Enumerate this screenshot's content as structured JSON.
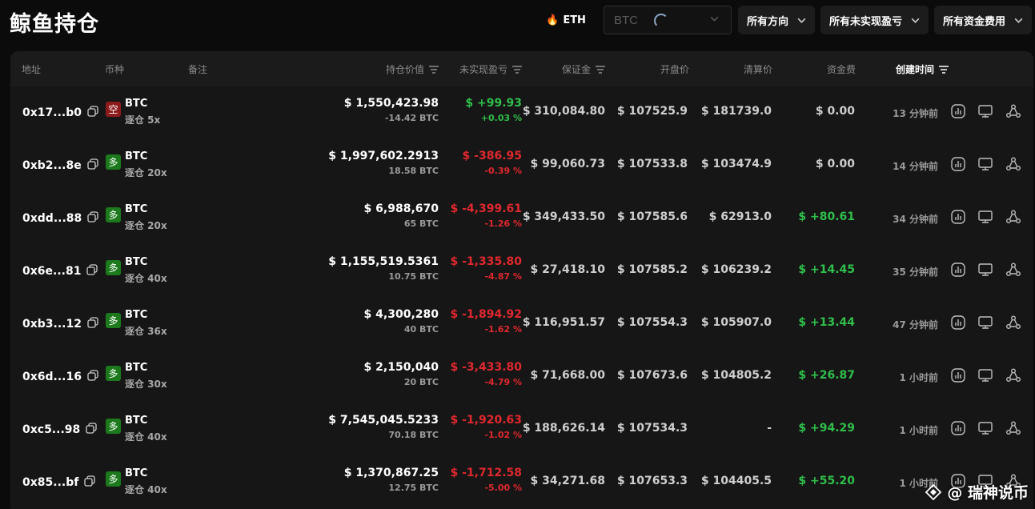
{
  "page": {
    "title": "鲸鱼持仓"
  },
  "toolbar": {
    "eth_label": "ETH",
    "search_placeholder": "BTC",
    "filters": [
      {
        "label": "所有方向"
      },
      {
        "label": "所有未实现盈亏"
      },
      {
        "label": "所有资金费用"
      }
    ]
  },
  "table": {
    "columns": {
      "address": "地址",
      "coin": "币种",
      "note": "备注",
      "position_value": "持仓价值",
      "unrealized_pnl": "未实现盈亏",
      "margin": "保证金",
      "entry_price": "开盘价",
      "liq_price": "清算价",
      "funding": "资金费",
      "created": "创建时间"
    },
    "rows": [
      {
        "address": "0x17...b0",
        "side": "空",
        "side_type": "short",
        "coin": "BTC",
        "mode": "逐仓 5x",
        "value": "$ 1,550,423.98",
        "size": "-14.42 BTC",
        "pnl": "$ +99.93",
        "pnl_pct": "+0.03 %",
        "pnl_sign": "pos",
        "margin": "$ 310,084.80",
        "entry": "$ 107525.9",
        "liq": "$ 181739.0",
        "fee": "$ 0.00",
        "fee_sign": "zero",
        "time": "13 分钟前"
      },
      {
        "address": "0xb2...8e",
        "side": "多",
        "side_type": "long",
        "coin": "BTC",
        "mode": "逐仓 20x",
        "value": "$ 1,997,602.2913",
        "size": "18.58 BTC",
        "pnl": "$ -386.95",
        "pnl_pct": "-0.39 %",
        "pnl_sign": "neg",
        "margin": "$ 99,060.73",
        "entry": "$ 107533.8",
        "liq": "$ 103474.9",
        "fee": "$ 0.00",
        "fee_sign": "zero",
        "time": "14 分钟前"
      },
      {
        "address": "0xdd...88",
        "side": "多",
        "side_type": "long",
        "coin": "BTC",
        "mode": "逐仓 20x",
        "value": "$ 6,988,670",
        "size": "65 BTC",
        "pnl": "$ -4,399.61",
        "pnl_pct": "-1.26 %",
        "pnl_sign": "neg",
        "margin": "$ 349,433.50",
        "entry": "$ 107585.6",
        "liq": "$ 62913.0",
        "fee": "$ +80.61",
        "fee_sign": "pos",
        "time": "34 分钟前"
      },
      {
        "address": "0x6e...81",
        "side": "多",
        "side_type": "long",
        "coin": "BTC",
        "mode": "逐仓 40x",
        "value": "$ 1,155,519.5361",
        "size": "10.75 BTC",
        "pnl": "$ -1,335.80",
        "pnl_pct": "-4.87 %",
        "pnl_sign": "neg",
        "margin": "$ 27,418.10",
        "entry": "$ 107585.2",
        "liq": "$ 106239.2",
        "fee": "$ +14.45",
        "fee_sign": "pos",
        "time": "35 分钟前"
      },
      {
        "address": "0xb3...12",
        "side": "多",
        "side_type": "long",
        "coin": "BTC",
        "mode": "逐仓 36x",
        "value": "$ 4,300,280",
        "size": "40 BTC",
        "pnl": "$ -1,894.92",
        "pnl_pct": "-1.62 %",
        "pnl_sign": "neg",
        "margin": "$ 116,951.57",
        "entry": "$ 107554.3",
        "liq": "$ 105907.0",
        "fee": "$ +13.44",
        "fee_sign": "pos",
        "time": "47 分钟前"
      },
      {
        "address": "0x6d...16",
        "side": "多",
        "side_type": "long",
        "coin": "BTC",
        "mode": "逐仓 30x",
        "value": "$ 2,150,040",
        "size": "20 BTC",
        "pnl": "$ -3,433.80",
        "pnl_pct": "-4.79 %",
        "pnl_sign": "neg",
        "margin": "$ 71,668.00",
        "entry": "$ 107673.6",
        "liq": "$ 104805.2",
        "fee": "$ +26.87",
        "fee_sign": "pos",
        "time": "1 小时前"
      },
      {
        "address": "0xc5...98",
        "side": "多",
        "side_type": "long",
        "coin": "BTC",
        "mode": "逐仓 40x",
        "value": "$ 7,545,045.5233",
        "size": "70.18 BTC",
        "pnl": "$ -1,920.63",
        "pnl_pct": "-1.02 %",
        "pnl_sign": "neg",
        "margin": "$ 188,626.14",
        "entry": "$ 107534.3",
        "liq": "-",
        "fee": "$ +94.29",
        "fee_sign": "pos",
        "time": "1 小时前"
      },
      {
        "address": "0x85...bf",
        "side": "多",
        "side_type": "long",
        "coin": "BTC",
        "mode": "逐仓 40x",
        "value": "$ 1,370,867.25",
        "size": "12.75 BTC",
        "pnl": "$ -1,712.58",
        "pnl_pct": "-5.00 %",
        "pnl_sign": "neg",
        "margin": "$ 34,271.68",
        "entry": "$ 107653.3",
        "liq": "$ 104405.5",
        "fee": "$ +55.20",
        "fee_sign": "pos",
        "time": "1 小时前"
      }
    ]
  },
  "watermark": {
    "text": "@ 瑞神说币"
  },
  "colors": {
    "positive": "#2fbf4a",
    "negative": "#e0282e",
    "short_badge": "#8e1b1b",
    "long_badge": "#1c7a1c"
  }
}
